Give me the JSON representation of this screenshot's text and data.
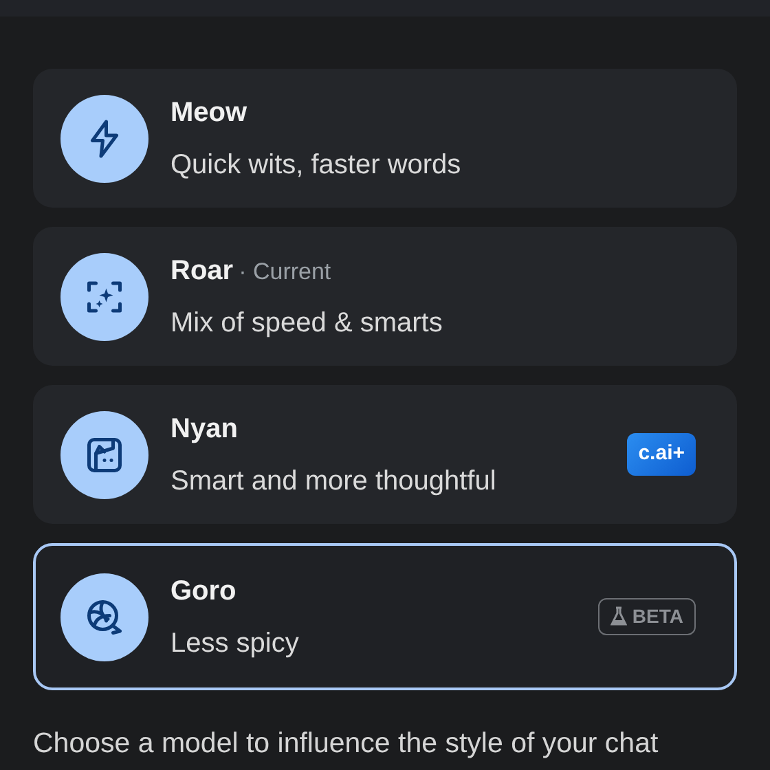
{
  "models": [
    {
      "name": "Meow",
      "description": "Quick wits, faster words",
      "selected": false
    },
    {
      "name": "Roar",
      "tag": "· Current",
      "description": "Mix of speed & smarts",
      "selected": false
    },
    {
      "name": "Nyan",
      "description": "Smart and more thoughtful",
      "badge": {
        "kind": "plus",
        "text": "c.ai+"
      },
      "selected": false
    },
    {
      "name": "Goro",
      "description": "Less spicy",
      "badge": {
        "kind": "beta",
        "text": "BETA"
      },
      "selected": true
    }
  ],
  "footer": "Choose a model to influence the style of your chat"
}
